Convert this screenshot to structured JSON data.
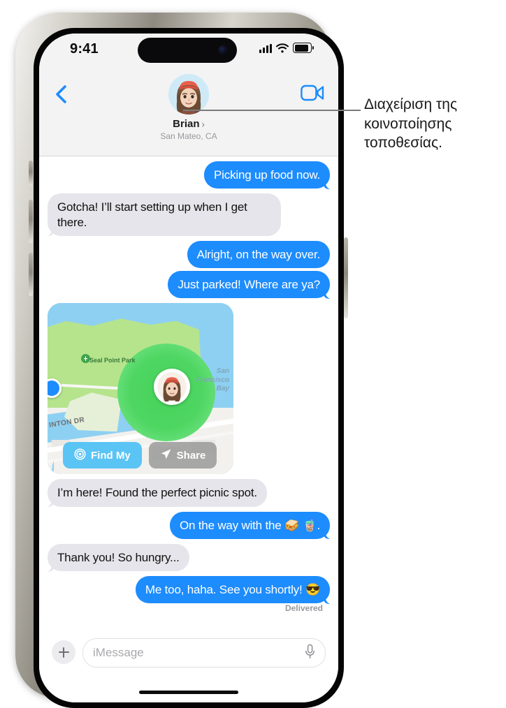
{
  "status_bar": {
    "time": "9:41",
    "cellular_icon": "cellular-signal-icon",
    "wifi_icon": "wifi-icon",
    "battery_icon": "battery-full-icon"
  },
  "nav_header": {
    "back_icon": "chevron-left-icon",
    "facetime_icon": "video-camera-icon",
    "avatar_icon": "memoji-avatar",
    "contact_name": "Brian",
    "contact_chevron": "›",
    "contact_location": "San Mateo, CA"
  },
  "conversation": {
    "messages": [
      {
        "id": 1,
        "side": "out",
        "text": "Picking up food now.",
        "tail": true
      },
      {
        "id": 2,
        "side": "in",
        "text": "Gotcha! I’ll start setting up when I get there.",
        "tail": true
      },
      {
        "id": 3,
        "side": "out",
        "text": "Alright, on the way over.",
        "tail": false
      },
      {
        "id": 4,
        "side": "out",
        "text": "Just parked! Where are ya?",
        "tail": true
      },
      {
        "id": 5,
        "side": "in",
        "text": "I’m here! Found the perfect picnic spot.",
        "tail": true
      },
      {
        "id": 6,
        "side": "out",
        "text": "On the way with the 🥪 🧋.",
        "tail": true
      },
      {
        "id": 7,
        "side": "in",
        "text": "Thank you! So hungry...",
        "tail": true
      },
      {
        "id": 8,
        "side": "out",
        "text": "Me too, haha. See you shortly! 😎",
        "tail": true
      }
    ],
    "delivered_label": "Delivered"
  },
  "map_message": {
    "park_label": "Seal Point Park",
    "bay_label_line1": "San",
    "bay_label_line2": "Francisco",
    "bay_label_line3": "Bay",
    "street_label": "INTON DR",
    "pin_icon": "memoji-location-pin",
    "current_location_icon": "blue-location-dot",
    "find_my_label": "Find My",
    "find_my_icon": "findmy-radar-icon",
    "share_label": "Share",
    "share_icon": "paper-plane-icon",
    "colors": {
      "find_my_bg": "#5ac4f5",
      "share_bg": "#969696",
      "halo": "#4ed662",
      "water": "#8ed0f2",
      "land": "#b6e48c"
    }
  },
  "composer": {
    "plus_icon": "plus-icon",
    "input_value": "",
    "input_placeholder": "iMessage",
    "mic_icon": "microphone-icon"
  },
  "callout": {
    "text": "Διαχείριση της κοινοποίησης τοποθεσίας.",
    "line_icon": "leader-line"
  },
  "theme": {
    "bubble_out": "#1d8cfd",
    "bubble_in": "#e6e5eb",
    "header_bg": "#f3f3f4",
    "accent_blue": "#1d8cfd"
  }
}
